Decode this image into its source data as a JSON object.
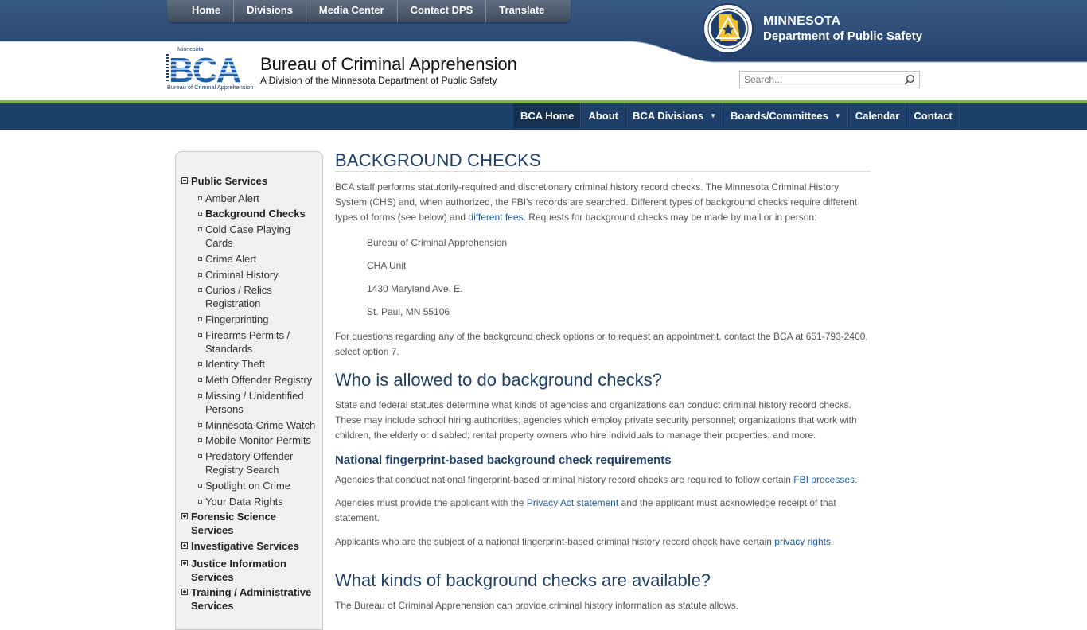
{
  "topnav": [
    "Home",
    "Divisions",
    "Media Center",
    "Contact DPS",
    "Translate"
  ],
  "dps": {
    "line1": "MINNESOTA",
    "line2": "Department of Public Safety",
    "seal_text": "DEPARTMENT OF PUBLIC SAFETY · STATE OF MINNESOTA"
  },
  "header": {
    "logo_top": "Minnesota",
    "logo_main": "BCA",
    "logo_bottom": "Bureau of Criminal Apprehension",
    "title": "Bureau of Criminal Apprehension",
    "subtitle": "A Division of the Minnesota Department of Public Safety"
  },
  "search": {
    "placeholder": "Search..."
  },
  "mainnav": [
    {
      "label": "BCA Home",
      "active": true,
      "dropdown": false
    },
    {
      "label": "About",
      "active": false,
      "dropdown": false
    },
    {
      "label": "BCA Divisions",
      "active": false,
      "dropdown": true
    },
    {
      "label": "Boards/Committees",
      "active": false,
      "dropdown": true
    },
    {
      "label": "Calendar",
      "active": false,
      "dropdown": false
    },
    {
      "label": "Contact",
      "active": false,
      "dropdown": false
    }
  ],
  "sidebar": {
    "public_services": "Public Services",
    "items": [
      {
        "label": "Amber Alert"
      },
      {
        "label": "Background Checks",
        "current": true
      },
      {
        "label": "Cold Case Playing Cards"
      },
      {
        "label": "Crime Alert"
      },
      {
        "label": "Criminal History"
      },
      {
        "label": "Curios / Relics Registration"
      },
      {
        "label": "Fingerprinting"
      },
      {
        "label": "Firearms Permits / Standards"
      },
      {
        "label": "Identity Theft"
      },
      {
        "label": "Meth Offender Registry"
      },
      {
        "label": "Missing / Unidentified Persons"
      },
      {
        "label": "Minnesota Crime Watch"
      },
      {
        "label": "Mobile Monitor Permits"
      },
      {
        "label": "Predatory Offender Registry Search"
      },
      {
        "label": "Spotlight on Crime"
      },
      {
        "label": "Your Data Rights"
      }
    ],
    "sections": [
      "Forensic Science Services",
      "Investigative Services",
      "Justice Information Services",
      "Training / Administrative Services"
    ]
  },
  "content": {
    "title": "BACKGROUND CHECKS",
    "intro_1": "BCA staff performs statutorily-required and discretionary criminal history record checks. The Minnesota Criminal History System (CHS) and, when authorized, the FBI's records are searched. Different types of background checks require different types of forms (see below) and ",
    "intro_link": "different fees",
    "intro_2": ". Requests for background checks may be made by mail or in person:",
    "address": [
      "Bureau of Criminal Apprehension",
      "CHA Unit",
      "1430 Maryland Ave. E.",
      "St. Paul, MN 55106"
    ],
    "contact": "For questions regarding any of the background check options or to request an appointment, contact the BCA at 651-793-2400, select option 7.",
    "h2_who": "Who is allowed to do background checks?",
    "who_text": "State and federal statutes determine what kinds of agencies and organizations can conduct criminal history record checks. These may include school hiring authorities; agencies which employ private security personnel; organizations that work with children, the elderly or disabled; rental property owners who hire individuals to manage their properties; and more.",
    "h3_national": "National fingerprint-based background check requirements",
    "nat1_a": "Agencies that conduct national fingerprint-based criminal history record checks are required to follow certain ",
    "nat1_link": "FBI processes",
    "nat1_b": ".",
    "nat2_a": "Agencies must provide the applicant with the ",
    "nat2_link": "Privacy Act statement",
    "nat2_b": " and the applicant must acknowledge receipt of that statement.",
    "nat3_a": "Applicants who are the subject of a national fingerprint-based criminal history record check have certain ",
    "nat3_link": "privacy rights",
    "nat3_b": ".",
    "h2_kinds": "What kinds of background checks are available?",
    "kinds_text": "The Bureau of Criminal Apprehension can provide criminal history information as statute allows."
  },
  "colors": {
    "navy": "#1f3f6b",
    "green": "#7ab648",
    "link": "#1a5a9e",
    "topband": "#2c4a73"
  }
}
